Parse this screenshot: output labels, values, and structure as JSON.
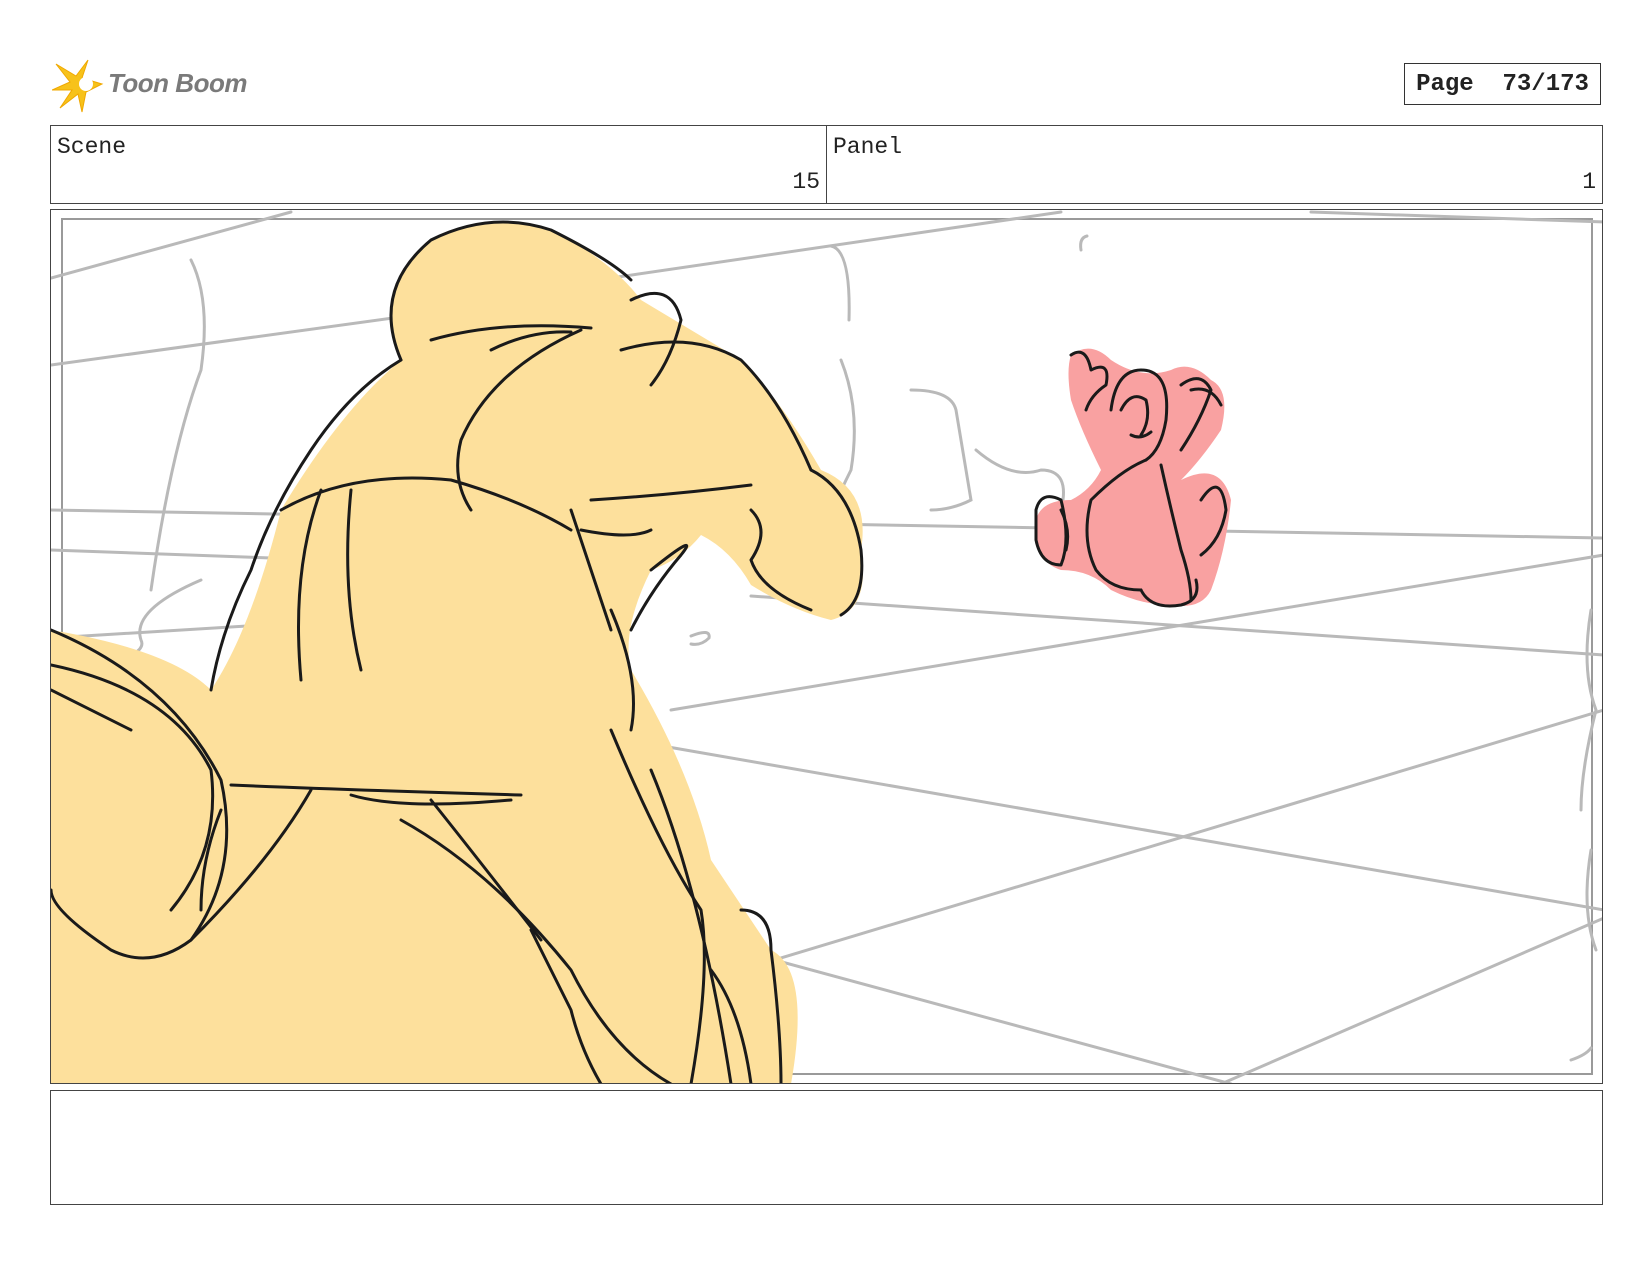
{
  "header": {
    "logo_text": "Toon Boom",
    "page_label": "Page",
    "page_number": "73/173"
  },
  "info": {
    "scene_label": "Scene",
    "scene_value": "15",
    "panel_label": "Panel",
    "panel_value": "1"
  },
  "colors": {
    "figure_fill": "#fde09c",
    "creature_fill": "#f9a1a1",
    "line": "#1a1a1a",
    "background_lines": "#b9b9b9",
    "logo_star": "#f7c21a"
  },
  "notes": {
    "text": ""
  }
}
